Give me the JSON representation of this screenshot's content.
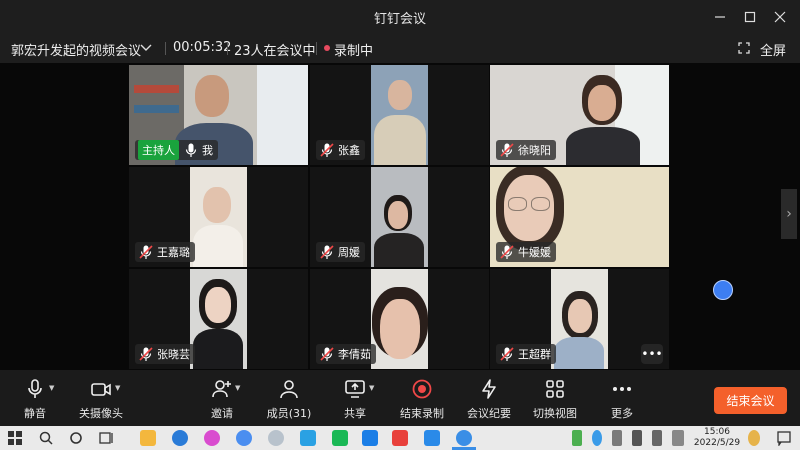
{
  "window": {
    "title": "钉钉会议"
  },
  "meeting": {
    "name": "郭宏升发起的视频会议",
    "duration": "00:05:32",
    "participants_status": "23人在会议中",
    "recording_status": "录制中",
    "fullscreen_label": "全屏"
  },
  "host_badge": "主持人",
  "tiles": [
    {
      "name": "我"
    },
    {
      "name": "张鑫"
    },
    {
      "name": "徐晓阳"
    },
    {
      "name": "王嘉璐"
    },
    {
      "name": "周媛"
    },
    {
      "name": "牛媛媛"
    },
    {
      "name": "张晓芸"
    },
    {
      "name": "李倩茹"
    },
    {
      "name": "王超群"
    }
  ],
  "toolbar": {
    "mute": "静音",
    "camera_off": "关摄像头",
    "invite": "邀请",
    "members": "成员(31)",
    "share": "共享",
    "end_recording": "结束录制",
    "minutes": "会议纪要",
    "switch_view": "切换视图",
    "more": "更多",
    "end_meeting": "结束会议"
  },
  "taskbar": {
    "time": "15:06",
    "date": "2022/5/29"
  },
  "colors": {
    "accent": "#f4602b",
    "host_badge": "#1aa33d",
    "record_dot": "#e84a5f"
  }
}
